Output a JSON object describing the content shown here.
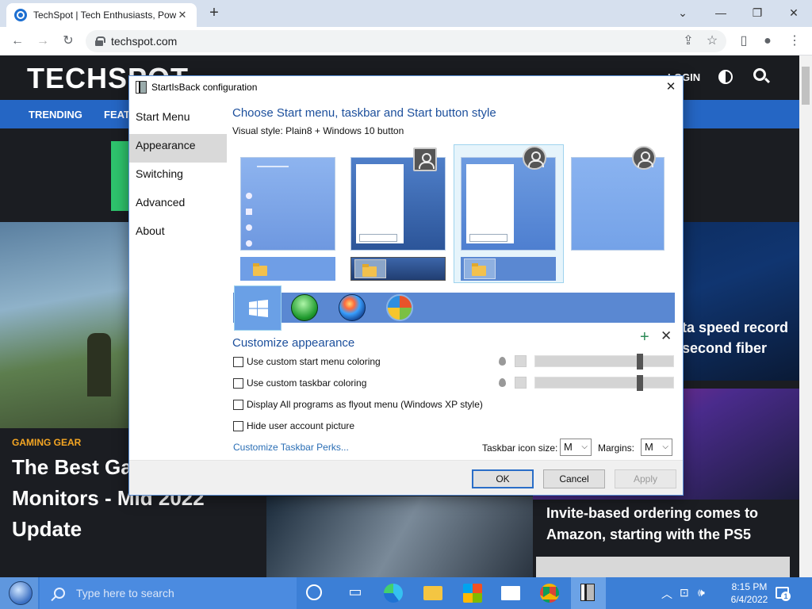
{
  "browser": {
    "tab_title": "TechSpot | Tech Enthusiasts, Pow",
    "url": "techspot.com"
  },
  "site": {
    "logo": "TECHSPOT",
    "login": "LOGIN",
    "nav": [
      "TRENDING",
      "FEAT"
    ],
    "tag_gaming": "GAMING GEAR",
    "headline_left": "The Best Gaming Monitors - Mid 2022 Update",
    "headline_right1": "ta speed record second fiber",
    "headline_right2": "Invite-based ordering comes to Amazon, starting with the PS5"
  },
  "dialog": {
    "title": "StartIsBack configuration",
    "sidebar": [
      "Start Menu",
      "Appearance",
      "Switching",
      "Advanced",
      "About"
    ],
    "active_item": "Appearance",
    "section_title": "Choose Start menu, taskbar and Start button style",
    "visual_style_label": "Visual style:",
    "visual_style_value": "Plain8 + Windows 10 button",
    "customize_title": "Customize appearance",
    "options": [
      {
        "label": "Use custom start menu coloring",
        "checked": false
      },
      {
        "label": "Use custom taskbar coloring",
        "checked": false
      },
      {
        "label": "Display All programs as flyout menu (Windows XP style)",
        "checked": false
      },
      {
        "label": "Hide user account picture",
        "checked": false
      }
    ],
    "sliders": [
      0.76,
      0.76
    ],
    "perks_link": "Customize Taskbar Perks...",
    "icon_size_label": "Taskbar icon size:",
    "icon_size_value": "M",
    "margins_label": "Margins:",
    "margins_value": "M",
    "ok": "OK",
    "cancel": "Cancel",
    "apply": "Apply"
  },
  "taskbar": {
    "search_placeholder": "Type here to search",
    "time": "8:15 PM",
    "date": "6/4/2022",
    "notifications": "1"
  },
  "colors": {
    "accent": "#3c7fd6",
    "dialog_heading": "#1c4f9c",
    "site_nav": "#2566c4"
  }
}
